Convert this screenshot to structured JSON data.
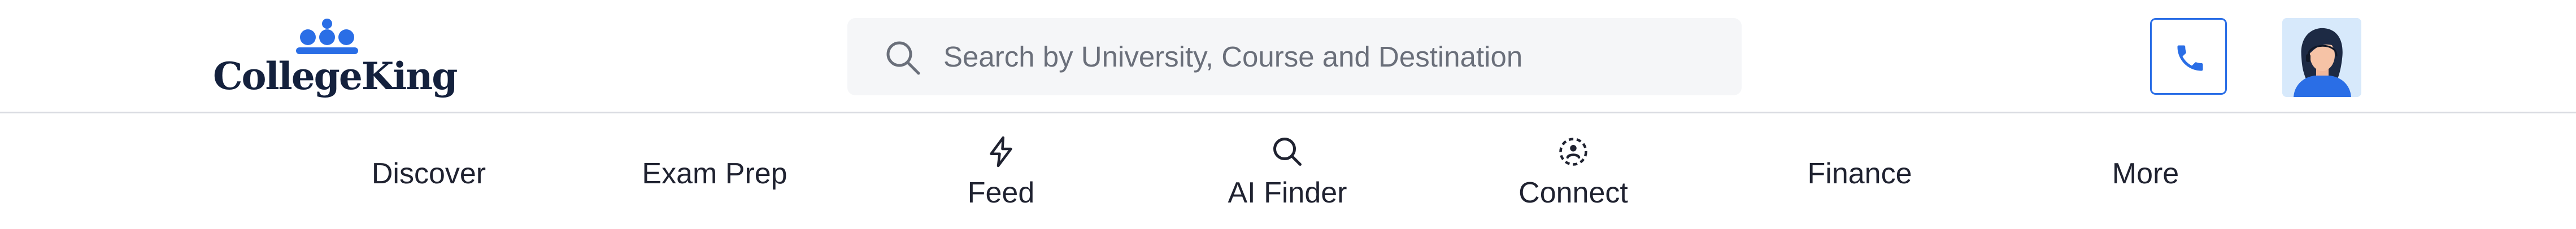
{
  "brand": {
    "name": "CollegeKing",
    "color": "#14213d",
    "crown_color": "#2a6ee6"
  },
  "search": {
    "placeholder": "Search by University, Course and Destination",
    "value": ""
  },
  "header": {
    "phone_icon": "phone-icon",
    "accent": "#2a6ee6"
  },
  "nav": {
    "items": [
      {
        "label": "Discover",
        "icon": null
      },
      {
        "label": "Exam Prep",
        "icon": null
      },
      {
        "label": "Feed",
        "icon": "lightning-icon"
      },
      {
        "label": "AI Finder",
        "icon": "search-icon"
      },
      {
        "label": "Connect",
        "icon": "connect-icon"
      },
      {
        "label": "Finance",
        "icon": null
      },
      {
        "label": "More",
        "icon": null
      }
    ]
  }
}
